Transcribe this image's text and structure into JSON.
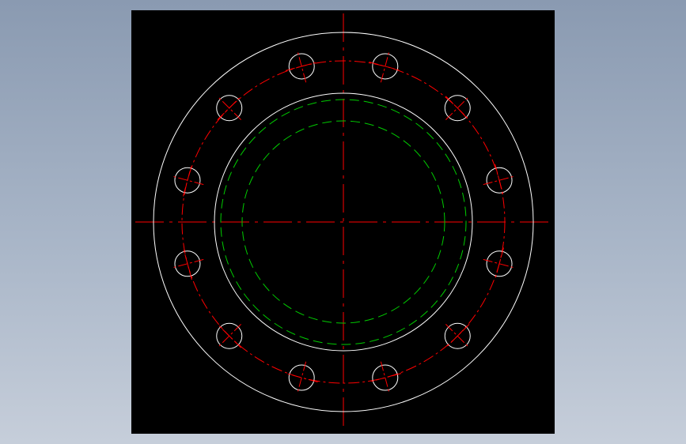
{
  "viewport": {
    "background": "#000000"
  },
  "drawing": {
    "subject": "flange-top-view",
    "bolt_hole_count": 12,
    "bolt_angle_offset_deg": 15,
    "colors": {
      "outline": "#ffffff",
      "centerline": "#ff0000",
      "hidden_line": "#00cc00"
    }
  }
}
